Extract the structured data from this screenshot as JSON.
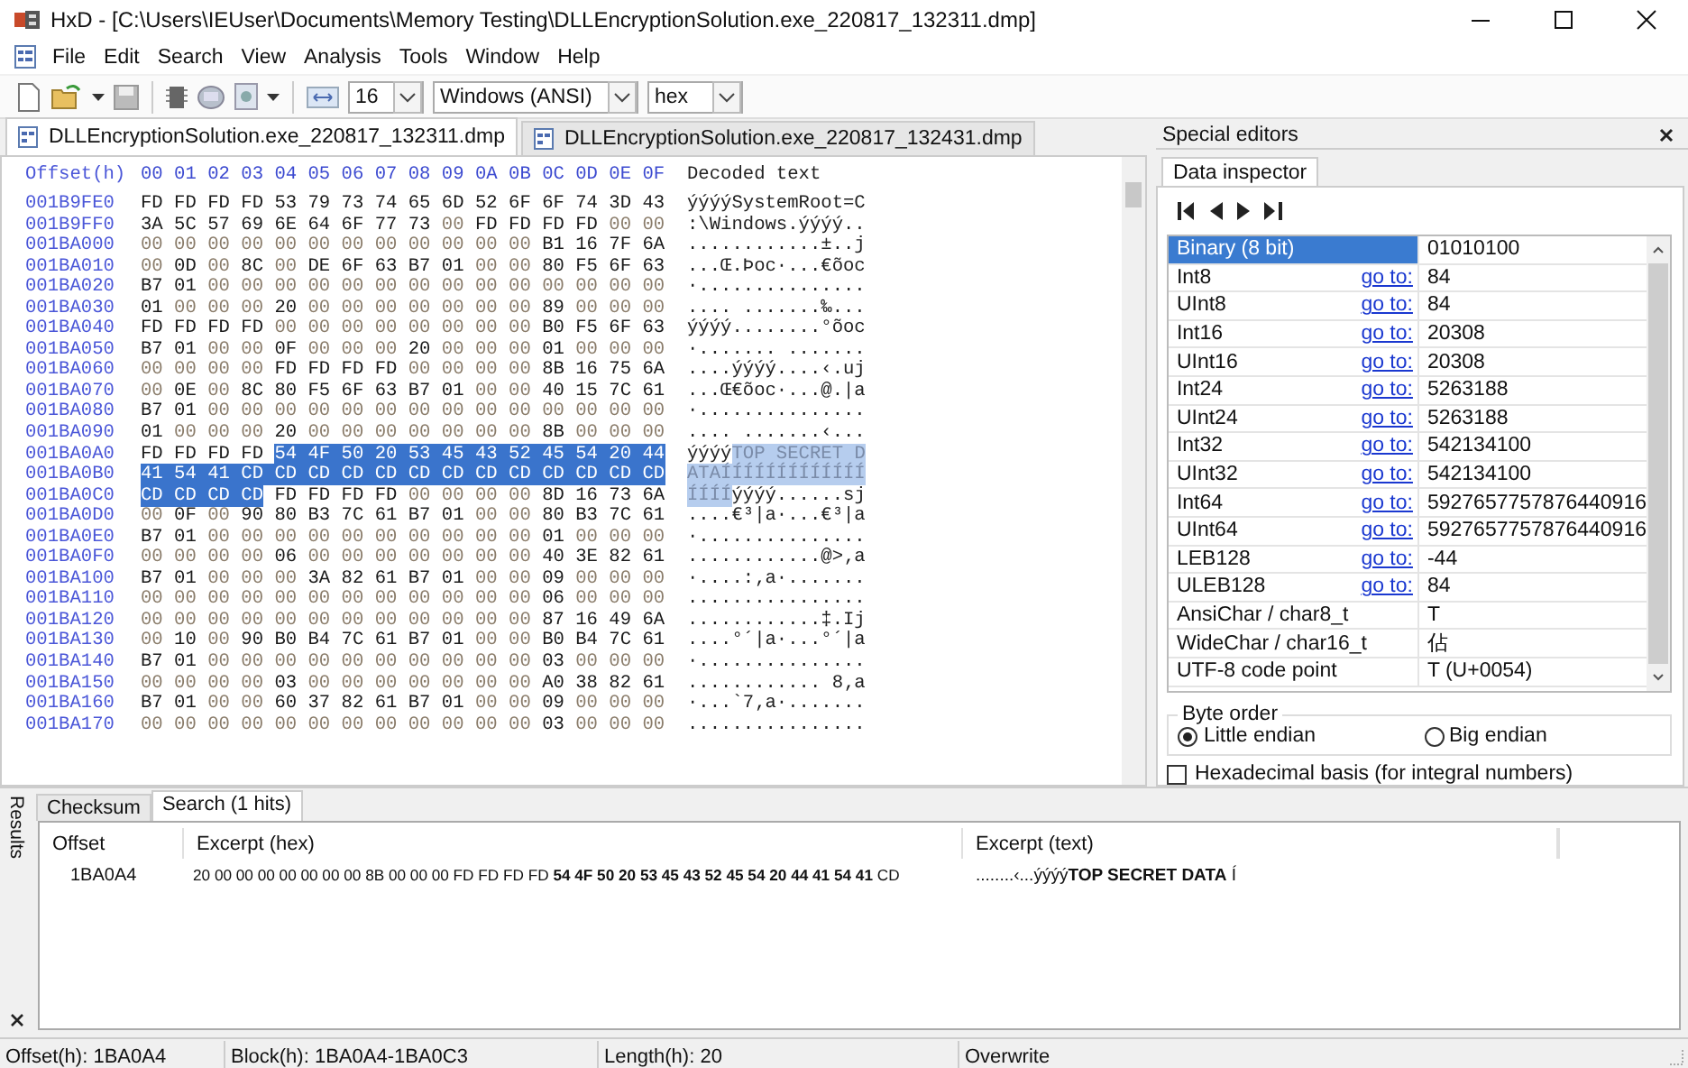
{
  "window": {
    "title": "HxD - [C:\\Users\\IEUser\\Documents\\Memory Testing\\DLLEncryptionSolution.exe_220817_132311.dmp]"
  },
  "menu": [
    "File",
    "Edit",
    "Search",
    "View",
    "Analysis",
    "Tools",
    "Window",
    "Help"
  ],
  "toolbar": {
    "bytes_per_row": "16",
    "charset": "Windows (ANSI)",
    "offset_base": "hex"
  },
  "document_tabs": [
    {
      "label": "DLLEncryptionSolution.exe_220817_132311.dmp",
      "selected": true
    },
    {
      "label": "DLLEncryptionSolution.exe_220817_132431.dmp",
      "selected": false
    }
  ],
  "hex_view": {
    "offset_header": "Offset(h)",
    "column_headers": [
      "00",
      "01",
      "02",
      "03",
      "04",
      "05",
      "06",
      "07",
      "08",
      "09",
      "0A",
      "0B",
      "0C",
      "0D",
      "0E",
      "0F"
    ],
    "text_header": "Decoded text",
    "rows": [
      {
        "offset": "001B9FE0",
        "hex": [
          {
            "bytes": "FD FD FD FD 53 79 73 74 65 6D 52 6F 6F 74 3D 43",
            "selected": false
          }
        ],
        "text": [
          {
            "chars": "ýýýýSystemRoot=C",
            "selected": false
          }
        ]
      },
      {
        "offset": "001B9FF0",
        "hex": [
          {
            "bytes": "3A 5C 57 69 6E 64 6F 77 73 00 FD FD FD FD 00 00",
            "selected": false
          }
        ],
        "text": [
          {
            "chars": ":\\Windows.ýýýý..",
            "selected": false
          }
        ]
      },
      {
        "offset": "001BA000",
        "hex": [
          {
            "bytes": "00 00 00 00 00 00 00 00 00 00 00 00 B1 16 7F 6A",
            "selected": false
          }
        ],
        "text": [
          {
            "chars": "............±..j",
            "selected": false
          }
        ]
      },
      {
        "offset": "001BA010",
        "hex": [
          {
            "bytes": "00 0D 00 8C 00 DE 6F 63 B7 01 00 00 80 F5 6F 63",
            "selected": false
          }
        ],
        "text": [
          {
            "chars": "...Œ.Þoc·...€õoc",
            "selected": false
          }
        ]
      },
      {
        "offset": "001BA020",
        "hex": [
          {
            "bytes": "B7 01 00 00 00 00 00 00 00 00 00 00 00 00 00 00",
            "selected": false
          }
        ],
        "text": [
          {
            "chars": "·...............",
            "selected": false
          }
        ]
      },
      {
        "offset": "001BA030",
        "hex": [
          {
            "bytes": "01 00 00 00 20 00 00 00 00 00 00 00 89 00 00 00",
            "selected": false
          }
        ],
        "text": [
          {
            "chars": ".... .......‰...",
            "selected": false
          }
        ]
      },
      {
        "offset": "001BA040",
        "hex": [
          {
            "bytes": "FD FD FD FD 00 00 00 00 00 00 00 00 B0 F5 6F 63",
            "selected": false
          }
        ],
        "text": [
          {
            "chars": "ýýýý........°õoc",
            "selected": false
          }
        ]
      },
      {
        "offset": "001BA050",
        "hex": [
          {
            "bytes": "B7 01 00 00 0F 00 00 00 20 00 00 00 01 00 00 00",
            "selected": false
          }
        ],
        "text": [
          {
            "chars": "·....... .......",
            "selected": false
          }
        ]
      },
      {
        "offset": "001BA060",
        "hex": [
          {
            "bytes": "00 00 00 00 FD FD FD FD 00 00 00 00 8B 16 75 6A",
            "selected": false
          }
        ],
        "text": [
          {
            "chars": "....ýýýý....‹.uj",
            "selected": false
          }
        ]
      },
      {
        "offset": "001BA070",
        "hex": [
          {
            "bytes": "00 0E 00 8C 80 F5 6F 63 B7 01 00 00 40 15 7C 61",
            "selected": false
          }
        ],
        "text": [
          {
            "chars": "...Œ€õoc·...@.|a",
            "selected": false
          }
        ]
      },
      {
        "offset": "001BA080",
        "hex": [
          {
            "bytes": "B7 01 00 00 00 00 00 00 00 00 00 00 00 00 00 00",
            "selected": false
          }
        ],
        "text": [
          {
            "chars": "·...............",
            "selected": false
          }
        ]
      },
      {
        "offset": "001BA090",
        "hex": [
          {
            "bytes": "01 00 00 00 20 00 00 00 00 00 00 00 8B 00 00 00",
            "selected": false
          }
        ],
        "text": [
          {
            "chars": ".... .......‹...",
            "selected": false
          }
        ]
      },
      {
        "offset": "001BA0A0",
        "hex": [
          {
            "bytes": "FD FD FD FD",
            "selected": false
          },
          {
            "bytes": "54 4F 50 20 53 45 43 52 45 54 20 44",
            "selected": true
          }
        ],
        "text": [
          {
            "chars": "ýýýý",
            "selected": false
          },
          {
            "chars": "TOP SECRET D",
            "selected": true
          }
        ]
      },
      {
        "offset": "001BA0B0",
        "hex": [
          {
            "bytes": "41 54 41 CD CD CD CD CD CD CD CD CD CD CD CD CD",
            "selected": true
          }
        ],
        "text": [
          {
            "chars": "ATAÍÍÍÍÍÍÍÍÍÍÍÍÍ",
            "selected": true
          }
        ]
      },
      {
        "offset": "001BA0C0",
        "hex": [
          {
            "bytes": "CD CD CD CD",
            "selected": true
          },
          {
            "bytes": "FD FD FD FD 00 00 00 00 8D 16 73 6A",
            "selected": false
          }
        ],
        "text": [
          {
            "chars": "ÍÍÍÍ",
            "selected": true
          },
          {
            "chars": "ýýýý......sj",
            "selected": false
          }
        ]
      },
      {
        "offset": "001BA0D0",
        "hex": [
          {
            "bytes": "00 0F 00 90 80 B3 7C 61 B7 01 00 00 80 B3 7C 61",
            "selected": false
          }
        ],
        "text": [
          {
            "chars": "....€³|a·...€³|a",
            "selected": false
          }
        ]
      },
      {
        "offset": "001BA0E0",
        "hex": [
          {
            "bytes": "B7 01 00 00 00 00 00 00 00 00 00 00 01 00 00 00",
            "selected": false
          }
        ],
        "text": [
          {
            "chars": "·...............",
            "selected": false
          }
        ]
      },
      {
        "offset": "001BA0F0",
        "hex": [
          {
            "bytes": "00 00 00 00 06 00 00 00 00 00 00 00 40 3E 82 61",
            "selected": false
          }
        ],
        "text": [
          {
            "chars": "............@>‚a",
            "selected": false
          }
        ]
      },
      {
        "offset": "001BA100",
        "hex": [
          {
            "bytes": "B7 01 00 00 00 3A 82 61 B7 01 00 00 09 00 00 00",
            "selected": false
          }
        ],
        "text": [
          {
            "chars": "·....:‚a·.......",
            "selected": false
          }
        ]
      },
      {
        "offset": "001BA110",
        "hex": [
          {
            "bytes": "00 00 00 00 00 00 00 00 00 00 00 00 06 00 00 00",
            "selected": false
          }
        ],
        "text": [
          {
            "chars": "................",
            "selected": false
          }
        ]
      },
      {
        "offset": "001BA120",
        "hex": [
          {
            "bytes": "00 00 00 00 00 00 00 00 00 00 00 00 87 16 49 6A",
            "selected": false
          }
        ],
        "text": [
          {
            "chars": "............‡.Ij",
            "selected": false
          }
        ]
      },
      {
        "offset": "001BA130",
        "hex": [
          {
            "bytes": "00 10 00 90 B0 B4 7C 61 B7 01 00 00 B0 B4 7C 61",
            "selected": false
          }
        ],
        "text": [
          {
            "chars": "....°´|a·...°´|a",
            "selected": false
          }
        ]
      },
      {
        "offset": "001BA140",
        "hex": [
          {
            "bytes": "B7 01 00 00 00 00 00 00 00 00 00 00 03 00 00 00",
            "selected": false
          }
        ],
        "text": [
          {
            "chars": "·...............",
            "selected": false
          }
        ]
      },
      {
        "offset": "001BA150",
        "hex": [
          {
            "bytes": "00 00 00 00 03 00 00 00 00 00 00 00 A0 38 82 61",
            "selected": false
          }
        ],
        "text": [
          {
            "chars": "............ 8‚a",
            "selected": false
          }
        ]
      },
      {
        "offset": "001BA160",
        "hex": [
          {
            "bytes": "B7 01 00 00 60 37 82 61 B7 01 00 00 09 00 00 00",
            "selected": false
          }
        ],
        "text": [
          {
            "chars": "·...`7‚a·.......",
            "selected": false
          }
        ]
      },
      {
        "offset": "001BA170",
        "hex": [
          {
            "bytes": "00 00 00 00 00 00 00 00 00 00 00 00 03 00 00 00",
            "selected": false
          }
        ],
        "text": [
          {
            "chars": "................",
            "selected": false
          }
        ]
      }
    ]
  },
  "special_editors": {
    "title": "Special editors",
    "tab": "Data inspector",
    "inspector_rows": [
      {
        "name": "Binary (8 bit)",
        "value": "01010100",
        "selected": true
      },
      {
        "name": "Int8",
        "link": "go to:",
        "value": "84",
        "selected": false
      },
      {
        "name": "UInt8",
        "link": "go to:",
        "value": "84",
        "selected": false
      },
      {
        "name": "Int16",
        "link": "go to:",
        "value": "20308",
        "selected": false
      },
      {
        "name": "UInt16",
        "link": "go to:",
        "value": "20308",
        "selected": false
      },
      {
        "name": "Int24",
        "link": "go to:",
        "value": "5263188",
        "selected": false
      },
      {
        "name": "UInt24",
        "link": "go to:",
        "value": "5263188",
        "selected": false
      },
      {
        "name": "Int32",
        "link": "go to:",
        "value": "542134100",
        "selected": false
      },
      {
        "name": "UInt32",
        "link": "go to:",
        "value": "542134100",
        "selected": false
      },
      {
        "name": "Int64",
        "link": "go to:",
        "value": "5927657757876440916",
        "selected": false
      },
      {
        "name": "UInt64",
        "link": "go to:",
        "value": "5927657757876440916",
        "selected": false
      },
      {
        "name": "LEB128",
        "link": "go to:",
        "value": "-44",
        "selected": false
      },
      {
        "name": "ULEB128",
        "link": "go to:",
        "value": "84",
        "selected": false
      },
      {
        "name": "AnsiChar / char8_t",
        "value": "T",
        "selected": false
      },
      {
        "name": "WideChar / char16_t",
        "value": "佔",
        "selected": false
      },
      {
        "name": "UTF-8 code point",
        "value": "T (U+0054)",
        "selected": false
      }
    ],
    "byte_order": {
      "label": "Byte order",
      "options": [
        {
          "label": "Little endian",
          "selected": true
        },
        {
          "label": "Big endian",
          "selected": false
        }
      ]
    },
    "hex_basis": {
      "label": "Hexadecimal basis (for integral numbers)",
      "checked": false
    }
  },
  "results": {
    "side_label": "Results",
    "tabs": [
      {
        "label": "Checksum",
        "selected": false
      },
      {
        "label": "Search (1 hits)",
        "selected": true
      }
    ],
    "columns": [
      "Offset",
      "Excerpt (hex)",
      "Excerpt (text)"
    ],
    "rows": [
      {
        "offset": "1BA0A4",
        "hex": "20 00 00 00 00 00 00 00 8B 00 00 00 FD FD FD FD **54 4F 50 20 53 45 43 52 45 54 20 44 41 54 41** CD",
        "text": "........‹...ýýýý**TOP SECRET DATA** Í"
      }
    ]
  },
  "status_bar": [
    "Offset(h): 1BA0A4",
    "Block(h): 1BA0A4-1BA0C3",
    "Length(h): 20",
    "Overwrite"
  ]
}
